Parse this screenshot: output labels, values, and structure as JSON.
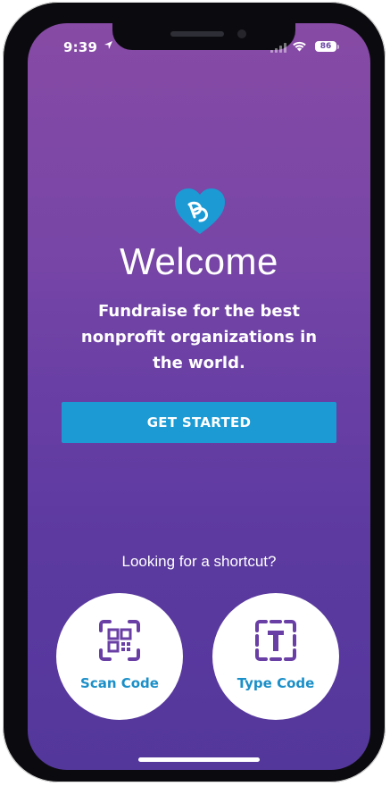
{
  "status_bar": {
    "time": "9:39",
    "battery": "86"
  },
  "welcome": {
    "title": "Welcome",
    "subtitle": "Fundraise for the best nonprofit organizations in the world."
  },
  "primary_action": {
    "label": "GET STARTED"
  },
  "shortcuts": {
    "prompt": "Looking for a shortcut?",
    "scan_label": "Scan Code",
    "type_label": "Type Code"
  },
  "icons": {
    "logo": "heart-logo-icon",
    "scan": "qr-code-icon",
    "type": "text-box-icon"
  },
  "colors": {
    "brand_blue": "#1b9ad4",
    "background_top": "#874aa5",
    "background_bottom": "#54379b",
    "icon_purple": "#6a3fa5"
  }
}
